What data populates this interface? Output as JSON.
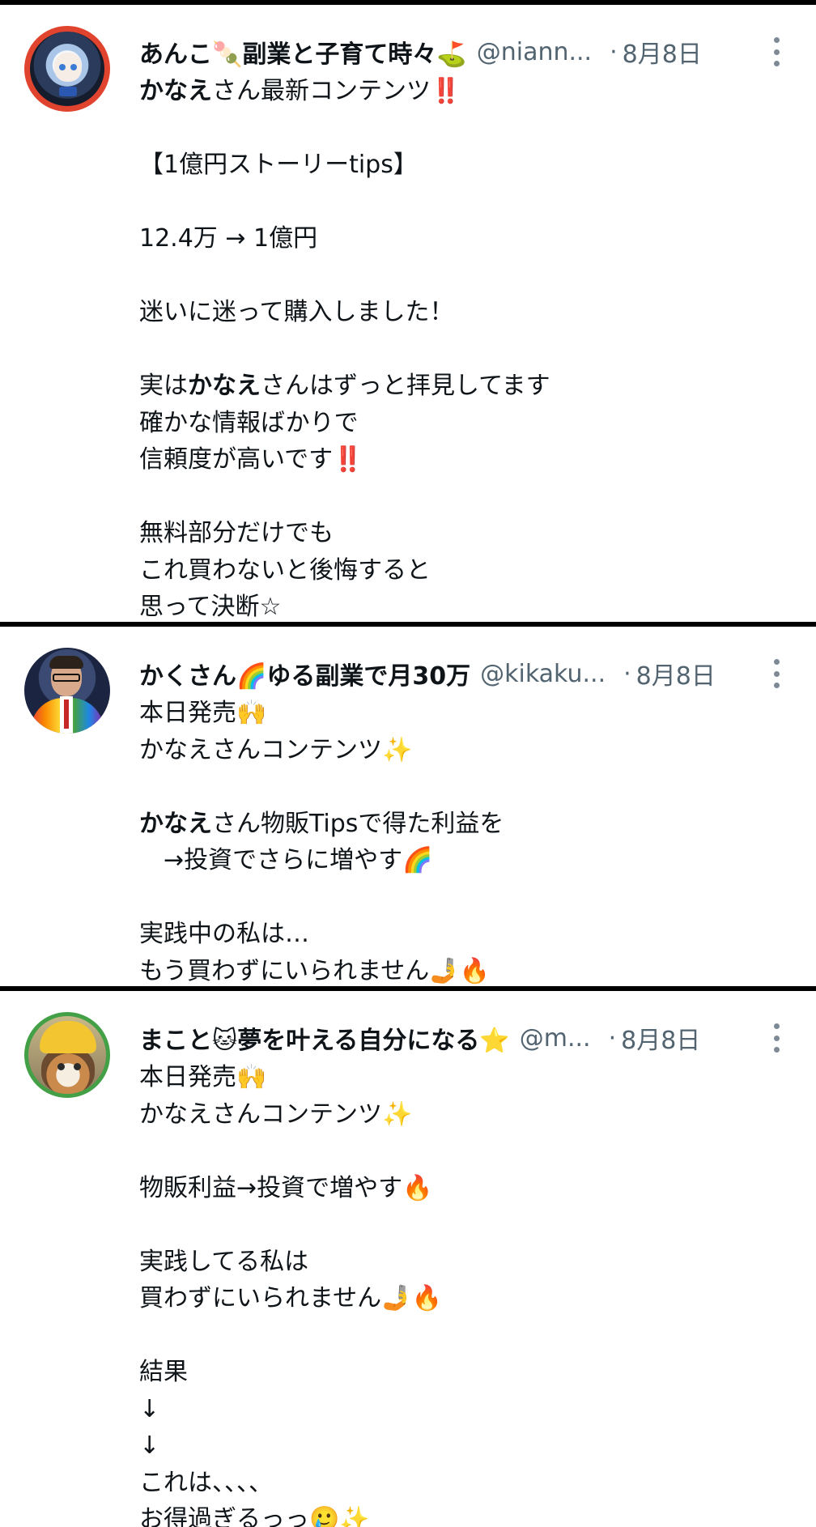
{
  "posts": [
    {
      "name": "あんこ🍡副業と子育て時々⛳",
      "handle": "@niann...",
      "separator": "·",
      "date": "8月8日",
      "lines": [
        "かなえさん最新コンテンツ‼️",
        "",
        "【1億円ストーリーtips】",
        "",
        "12.4万 → 1億円",
        "",
        "迷いに迷って購入しました！",
        "",
        "実はかなえさんはずっと拝見してます",
        "確かな情報ばかりで",
        "信頼度が高いです‼️",
        "",
        "無料部分だけでも",
        "これ買わないと後悔すると",
        "思って決断☆"
      ]
    },
    {
      "name": "かくさん🌈ゆる副業で月30万",
      "handle": "@kikaku...",
      "separator": "·",
      "date": "8月8日",
      "lines": [
        "本日発売🙌",
        "かなえさんコンテンツ✨",
        "",
        "かなえさん物販Tipsで得た利益を",
        "　→投資でさらに増やす🌈",
        "",
        "実践中の私は…",
        "もう買わずにいられません🤳🔥"
      ]
    },
    {
      "name": "まこと🐱夢を叶える自分になる⭐",
      "handle": "@m...",
      "separator": "·",
      "date": "8月8日",
      "lines": [
        "本日発売🙌",
        "かなえさんコンテンツ✨",
        "",
        "物販利益→投資で増やす🔥",
        "",
        "実践してる私は",
        "買わずにいられません🤳🔥",
        "",
        "結果",
        "↓",
        "↓",
        "これは、、、、",
        "お得過ぎるっっ🥲✨"
      ]
    }
  ],
  "icons": {
    "more": "more-vertical-icon",
    "colors": {
      "name": "#0f1419",
      "meta": "#536471",
      "divider": "#000000"
    }
  }
}
